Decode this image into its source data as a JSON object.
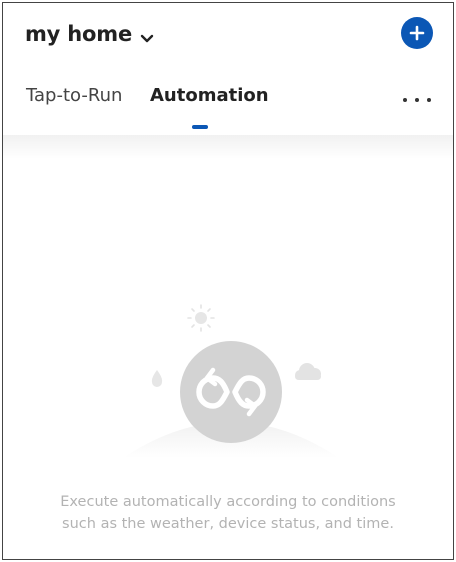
{
  "header": {
    "home_name": "my home",
    "home_dropdown_icon": "chevron-down-icon",
    "add_icon": "plus-circle-icon"
  },
  "tabs": [
    {
      "label": "Tap-to-Run",
      "selected": false
    },
    {
      "label": "Automation",
      "selected": true
    }
  ],
  "more_icon": "more-horizontal-icon",
  "empty_state": {
    "illustration_icon": "automation-loop-icon",
    "message": "Execute automatically according to conditions such as the weather, device status, and time."
  },
  "colors": {
    "accent": "#0b57b5",
    "text_primary": "#222222",
    "text_secondary": "#444444",
    "empty_text": "#b3b3b3",
    "illustration": "#d3d3d3"
  }
}
